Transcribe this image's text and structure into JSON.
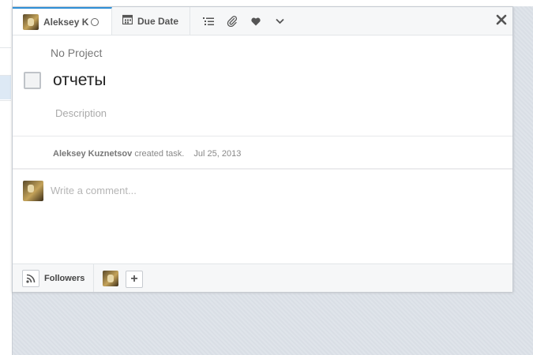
{
  "toolbar": {
    "assignee_name": "Aleksey K",
    "due_date_label": "Due Date",
    "icons": [
      "subtasks-icon",
      "attachment-icon",
      "heart-icon",
      "chevron-down-icon",
      "close-icon"
    ]
  },
  "task": {
    "project": "No Project",
    "title": "отчеты",
    "description_placeholder": "Description"
  },
  "activity": {
    "author": "Aleksey Kuznetsov",
    "action": "created task.",
    "date": "Jul 25, 2013"
  },
  "comment": {
    "placeholder": "Write a comment..."
  },
  "footer": {
    "followers_label": "Followers",
    "add_label": "+"
  },
  "colors": {
    "accent": "#2f8fd6",
    "background": "#dfe4ea"
  }
}
